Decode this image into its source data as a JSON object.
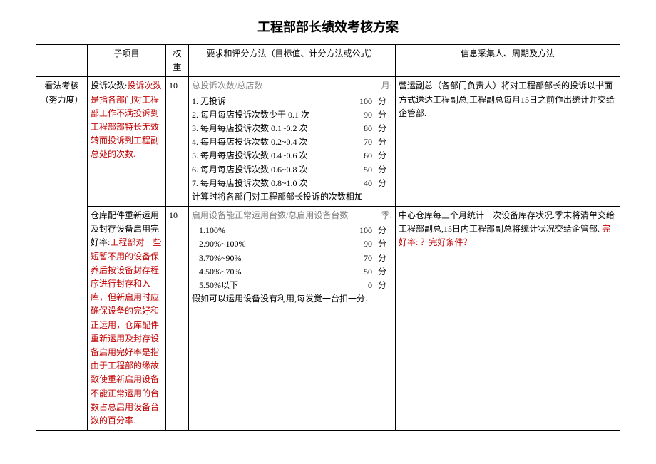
{
  "title": "工程部部长绩效考核方案",
  "headers": {
    "category": "",
    "subitem": "子项目",
    "weight": "权重",
    "criteria": "要求和评分方法（目标值、计分方法或公式）",
    "info": "信息采集人、周期及方法"
  },
  "rows": [
    {
      "category": "看法考核（努力度）",
      "sub_prefix": "投诉次数:",
      "sub_red": "投诉次数是指各部门对工程部工作不满投诉到工程部部特长无效转而投诉到工程副总处的次数.",
      "weight": "10",
      "criteria_head_left": "总投诉次数/总店数",
      "criteria_head_right": "月:",
      "score_lines": [
        {
          "l": "1. 无投诉",
          "v": "100",
          "u": "分"
        },
        {
          "l": "2. 每月每店投诉次数少于 0.1 次",
          "v": "90",
          "u": "分"
        },
        {
          "l": "3. 每月每店投诉次数 0.1~0.2 次",
          "v": "80",
          "u": "分"
        },
        {
          "l": "4. 每月每店投诉次数 0.2~0.4 次",
          "v": "70",
          "u": "分"
        },
        {
          "l": "5. 每月每店投诉次数 0.4~0.6 次",
          "v": "60",
          "u": "分"
        },
        {
          "l": "6. 每月每店投诉次数 0.6~0.8 次",
          "v": "50",
          "u": "分"
        },
        {
          "l": "7. 每月每店投诉次数 0.8~1.0 次",
          "v": "40",
          "u": "分"
        }
      ],
      "criteria_foot_black": "计算时将各部门对工程部部长投诉的次数相加",
      "info": "营运副总（各部门负责人）将对工程部部长的投诉以书面方式送达工程副总,工程副总每月15日之前作出统计并交给企管部."
    },
    {
      "sub_prefix": "仓库配件重新运用及封存设备启用完好率:",
      "sub_red": "工程部对一些短暂不用的设备保养后按设备封存程序进行封存和入库，但新启用时应确保设备的完好和正运用，仓库配件重新运用及封存设备启用完好率是指由于工程部的缘故致使重新启用设备不能正常运用的台数占总启用设备台数的百分率.",
      "weight": "10",
      "criteria_head_left": "启用设备能正常运用台数/总启用设备台数",
      "criteria_head_right": "季:",
      "score_lines": [
        {
          "l": "1.100%",
          "v": "100",
          "u": "分"
        },
        {
          "l": "2.90%~100%",
          "v": "90",
          "u": "分"
        },
        {
          "l": "3.70%~90%",
          "v": "70",
          "u": "分"
        },
        {
          "l": "4.50%~70%",
          "v": "50",
          "u": "分"
        },
        {
          "l": "5.50%以下",
          "v": "0",
          "u": "分"
        }
      ],
      "criteria_foot_black": "假如可以运用设备没有利用,每发觉一台扣一分.",
      "info_black": "中心仓库每三个月统计一次设备库存状况.季末将清单交给工程部副总,15日内工程部副总将统计状况交给企管部.",
      "info_red": "完好率: ？完好条件？"
    }
  ]
}
